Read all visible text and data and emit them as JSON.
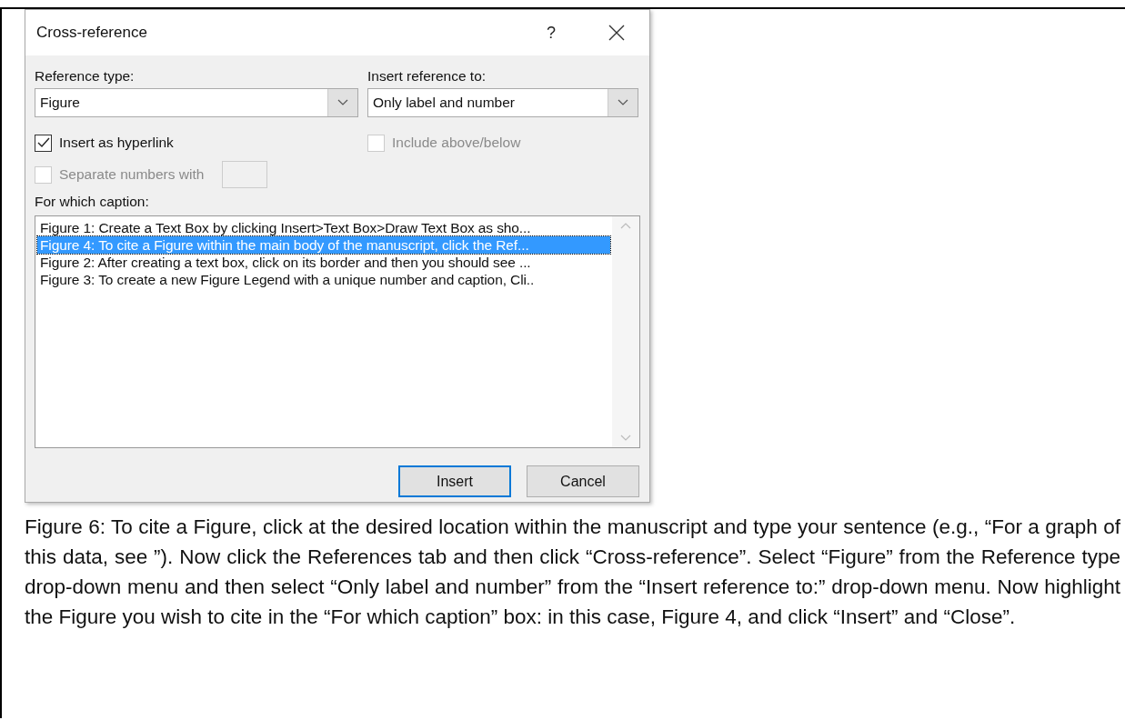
{
  "dialog": {
    "title": "Cross-reference",
    "help": "?",
    "reference_type": {
      "label": "Reference type:",
      "value": "Figure"
    },
    "insert_reference_to": {
      "label": "Insert reference to:",
      "value": "Only label and number"
    },
    "options": [
      {
        "label": "Insert as hyperlink",
        "checked": true,
        "disabled": false
      },
      {
        "label": "Include above/below",
        "checked": false,
        "disabled": true
      }
    ],
    "separate_numbers": {
      "label": "Separate numbers with",
      "checked": false,
      "disabled": true
    },
    "caption_label": "For which caption:",
    "captions": [
      {
        "text": "Figure 1: Create a Text Box by clicking Insert>Text Box>Draw Text Box as sho...",
        "selected": false
      },
      {
        "text": "Figure 4: To cite a Figure within the main body of the manuscript, click the Ref...",
        "selected": true
      },
      {
        "text": "Figure 2: After creating a text box, click on its border and then you should see ...",
        "selected": false
      },
      {
        "text": "Figure 3: To create a new Figure Legend with a unique number and caption, Cli..",
        "selected": false
      }
    ],
    "buttons": [
      {
        "label": "Insert",
        "default": true
      },
      {
        "label": "Cancel",
        "default": false
      }
    ]
  },
  "figure_caption": "Figure 6: To cite a Figure, click at the desired location within the manuscript and type your sentence (e.g., “For a graph of this data, see ”). Now click the References tab and then click “Cross-reference”. Select “Figure” from the Reference type drop-down menu and then select “Only label and number” from the “Insert reference to:” drop-down menu. Now highlight the Figure you wish to cite in the “For which caption” box: in this case, Figure 4, and click “Insert” and “Close”."
}
